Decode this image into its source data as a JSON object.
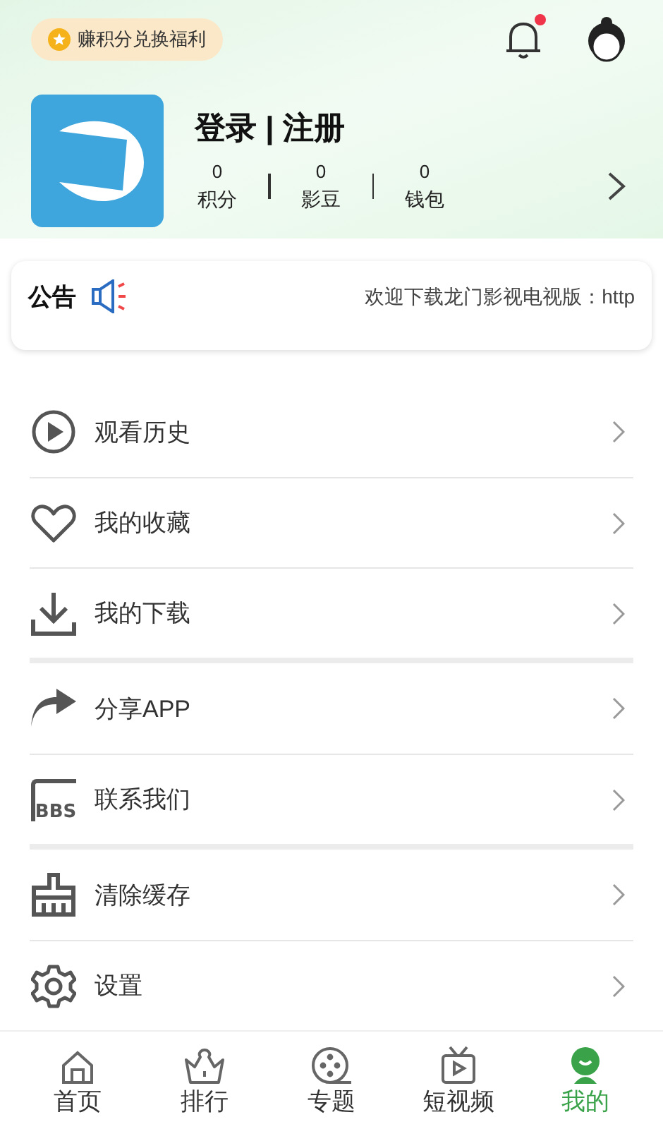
{
  "header": {
    "reward_badge": "赚积分兑换福利",
    "notification_unread": true
  },
  "profile": {
    "title": "登录 | 注册",
    "stats": [
      {
        "value": "0",
        "label": "积分"
      },
      {
        "value": "0",
        "label": "影豆"
      },
      {
        "value": "0",
        "label": "钱包"
      }
    ]
  },
  "notice": {
    "label": "公告",
    "text": "欢迎下载龙门影视电视版：http"
  },
  "menu_groups": [
    [
      {
        "kind": "history",
        "label": "观看历史"
      },
      {
        "kind": "favorite",
        "label": "我的收藏"
      },
      {
        "kind": "download",
        "label": "我的下载"
      }
    ],
    [
      {
        "kind": "share",
        "label": "分享APP"
      },
      {
        "kind": "bbs",
        "label": "联系我们",
        "icon_text": "BBS"
      }
    ],
    [
      {
        "kind": "clear",
        "label": "清除缓存"
      },
      {
        "kind": "settings",
        "label": "设置"
      }
    ]
  ],
  "tab_bar": [
    {
      "kind": "home",
      "label": "首页",
      "selected": false
    },
    {
      "kind": "rank",
      "label": "排行",
      "selected": false
    },
    {
      "kind": "topic",
      "label": "专题",
      "selected": false
    },
    {
      "kind": "short",
      "label": "短视频",
      "selected": false
    },
    {
      "kind": "me",
      "label": "我的",
      "selected": true
    }
  ]
}
